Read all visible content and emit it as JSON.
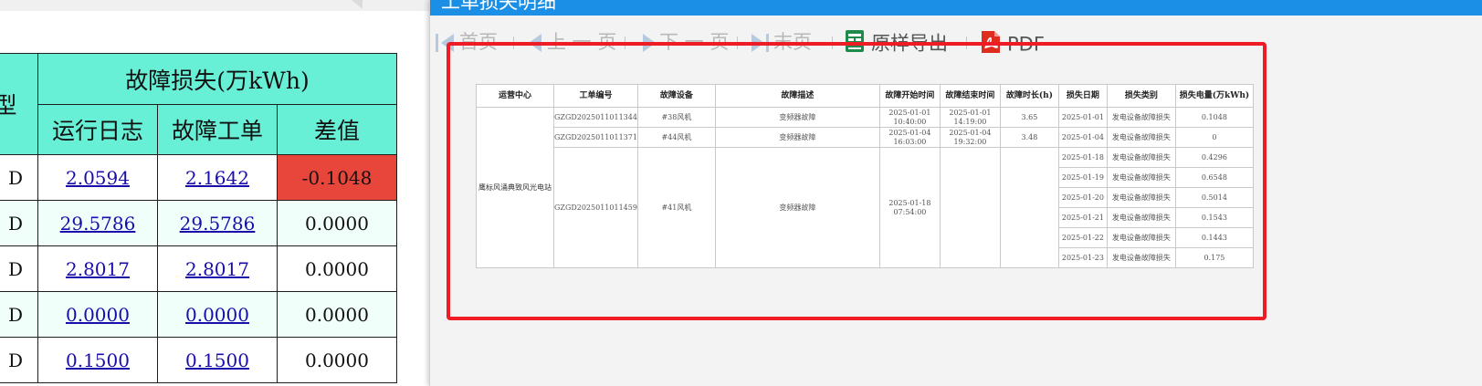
{
  "left_table": {
    "group_header": "故障损失(万kWh)",
    "type_header_partial": "型",
    "sub_headers": [
      "运行日志",
      "故障工单",
      "差值"
    ],
    "rows": [
      {
        "type": "D",
        "log": "2.0594",
        "order": "2.1642",
        "diff": "-0.1048",
        "diff_negative": true
      },
      {
        "type": "D",
        "log": "29.5786",
        "order": "29.5786",
        "diff": "0.0000",
        "diff_negative": false
      },
      {
        "type": "D",
        "log": "2.8017",
        "order": "2.8017",
        "diff": "0.0000",
        "diff_negative": false
      },
      {
        "type": "D",
        "log": "0.0000",
        "order": "0.0000",
        "diff": "0.0000",
        "diff_negative": false
      },
      {
        "type": "D",
        "log": "0.1500",
        "order": "0.1500",
        "diff": "0.0000",
        "diff_negative": false
      }
    ]
  },
  "popup": {
    "title": "工单损失明细",
    "toolbar": {
      "first": "首页",
      "prev": "上 一 页",
      "next": "下 一 页",
      "last": "末页",
      "export": "原样导出",
      "pdf": "PDF"
    }
  },
  "report": {
    "headers": [
      "运营中心",
      "工单编号",
      "故障设备",
      "故障描述",
      "故障开始时间",
      "故障结束时间",
      "故障时长(h)",
      "损失日期",
      "损失类别",
      "损失电量(万kWh)"
    ],
    "center": "鹰标风涌典致风光电站",
    "orders": [
      {
        "no": "GZGD2025011011344",
        "device": "#38风机",
        "desc": "变频器故障",
        "start_date": "2025-01-01",
        "start_time": "10:40:00",
        "end_date": "2025-01-01",
        "end_time": "14:19:00",
        "duration": "3.65"
      },
      {
        "no": "GZGD2025011011371",
        "device": "#44风机",
        "desc": "变频器故障",
        "start_date": "2025-01-04",
        "start_time": "16:03:00",
        "end_date": "2025-01-04",
        "end_time": "19:32:00",
        "duration": "3.48"
      },
      {
        "no": "GZGD2025011011459",
        "device": "#41风机",
        "desc": "变频器故障",
        "start_date": "2025-01-18",
        "start_time": "07:54:00",
        "end_date": "",
        "end_time": "",
        "duration": ""
      }
    ],
    "losses": [
      {
        "date": "2025-01-01",
        "category": "发电设备故障损失",
        "amount": "0.1048"
      },
      {
        "date": "2025-01-04",
        "category": "发电设备故障损失",
        "amount": "0"
      },
      {
        "date": "2025-01-18",
        "category": "发电设备故障损失",
        "amount": "0.4296"
      },
      {
        "date": "2025-01-19",
        "category": "发电设备故障损失",
        "amount": "0.6548"
      },
      {
        "date": "2025-01-20",
        "category": "发电设备故障损失",
        "amount": "0.5014"
      },
      {
        "date": "2025-01-21",
        "category": "发电设备故障损失",
        "amount": "0.1543"
      },
      {
        "date": "2025-01-22",
        "category": "发电设备故障损失",
        "amount": "0.1443"
      },
      {
        "date": "2025-01-23",
        "category": "发电设备故障损失",
        "amount": "0.175"
      }
    ]
  },
  "colors": {
    "header_teal": "#67f0d6",
    "negative_red": "#e8463a",
    "titlebar_blue": "#1a8fe5",
    "highlight_red": "#ee1c24"
  }
}
